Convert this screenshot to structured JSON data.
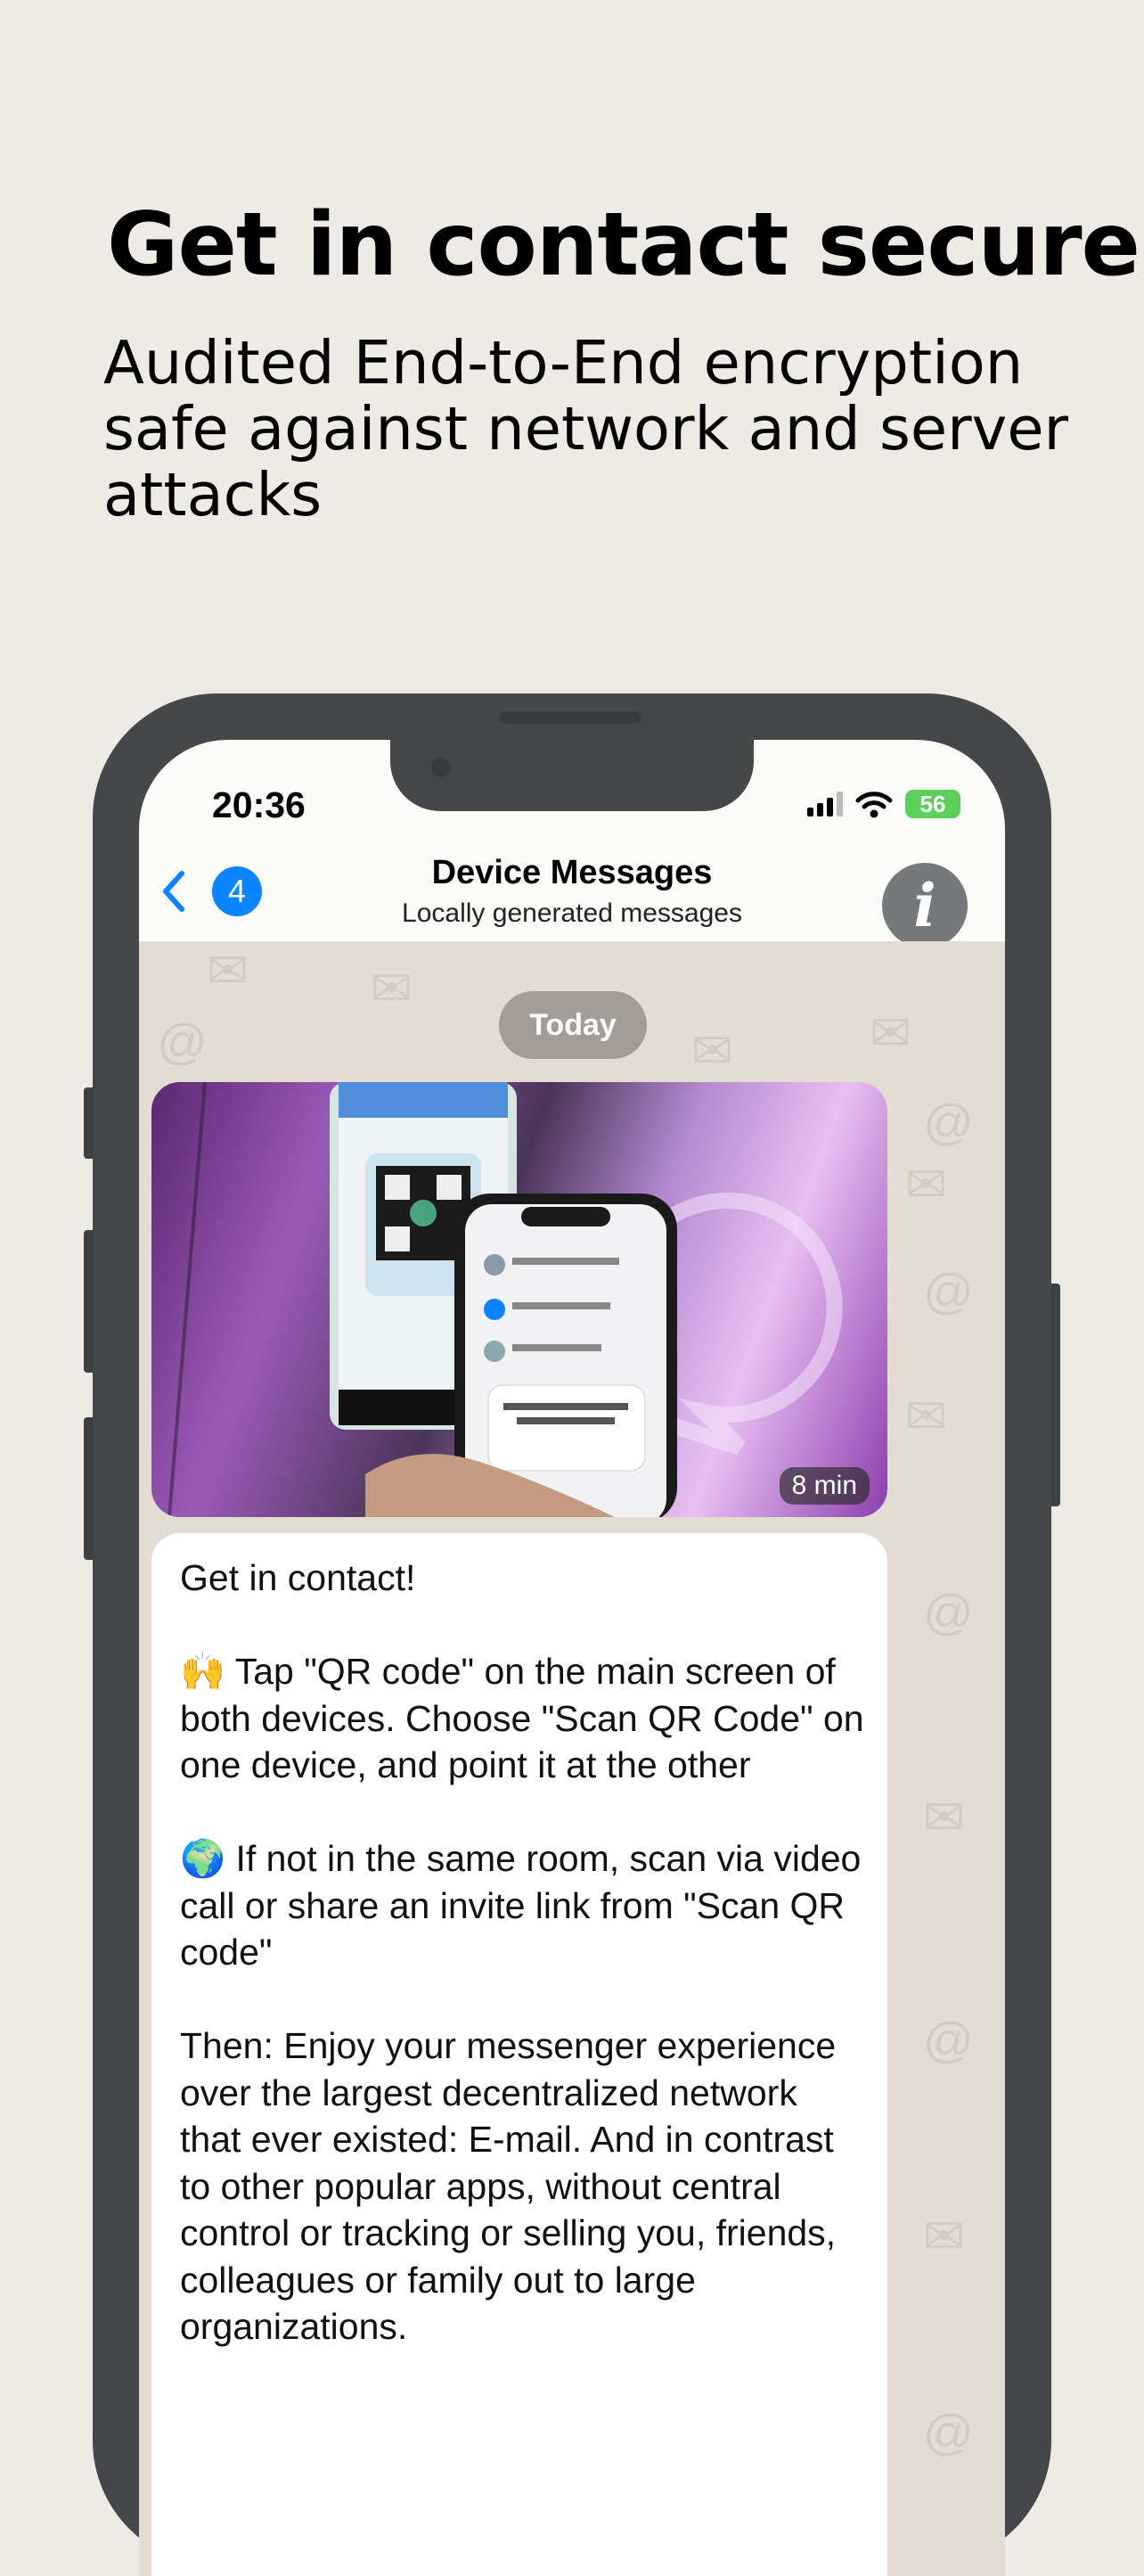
{
  "promo": {
    "headline": "Get in contact secure",
    "subheadline": "Audited End-to-End encryption safe against network and server attacks"
  },
  "status_bar": {
    "time": "20:36",
    "battery": "56"
  },
  "navbar": {
    "back_count": "4",
    "title": "Device Messages",
    "subtitle": "Locally generated messages",
    "info_glyph": "i"
  },
  "chat": {
    "day_label": "Today",
    "media": {
      "duration": "8 min",
      "shows": "video thumbnail of two phones scanning a QR code"
    },
    "message_text": "Get in contact!\n\n🙌 Tap \"QR code\" on the main screen of both devices. Choose \"Scan QR Code\" on one device, and point it at the other\n\n🌍 If not in the same room, scan via video call or share an invite link from \"Scan QR code\"\n\nThen: Enjoy your messenger experience over the largest decentralized network that ever existed: E-mail. And in contrast to other popular apps, without central control or tracking or selling you, friends, colleagues or family out to large organizations."
  },
  "colors": {
    "page_bg": "#eeebe7",
    "phone_frame": "#464749",
    "accent_blue": "#0a84ff",
    "chat_bg": "#e3dcd3",
    "battery_green": "#5ccf5a"
  },
  "icons": [
    "chevron-left-icon",
    "info-icon",
    "signal-icon",
    "wifi-icon",
    "battery-icon"
  ]
}
